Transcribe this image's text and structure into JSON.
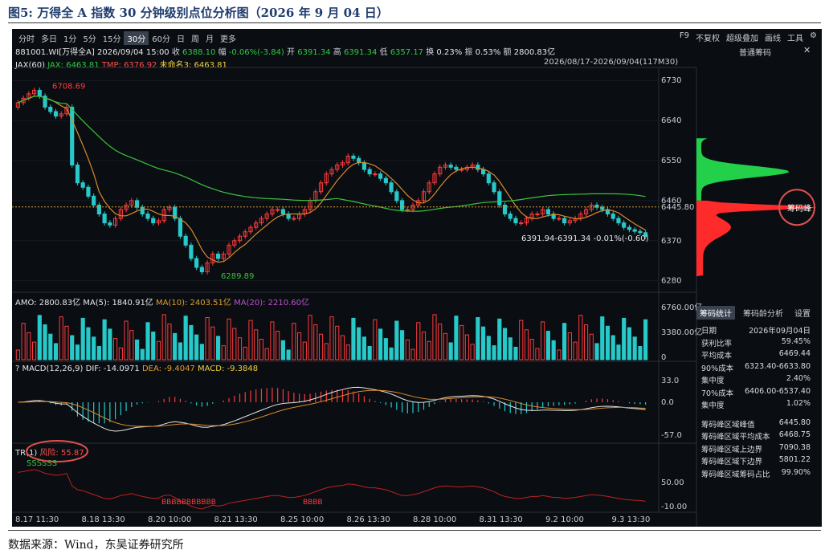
{
  "caption": "图5: 万得全 A 指数 30 分钟级别点位分析图（2026 年 9 月 04 日）",
  "source": "数据来源：Wind，东吴证券研究所",
  "tabs": [
    "分时",
    "多日",
    "1分",
    "5分",
    "15分",
    "30分",
    "60分",
    "日",
    "周",
    "月",
    "更多"
  ],
  "active_tab": "30分",
  "tools": [
    "F9",
    "不复权",
    "超级叠加",
    "画线",
    "工具"
  ],
  "info_line": {
    "code": "881001.WI[万得全A]",
    "datetime": "2026/09/04 15:00",
    "close_lbl": "收",
    "close": "6388.10",
    "chg_lbl": "幅",
    "chg": "-0.06%(-3.84)",
    "open_lbl": "开",
    "open": "6391.34",
    "high_lbl": "高",
    "high": "6391.34",
    "low_lbl": "低",
    "low": "6357.17",
    "turn_lbl": "换",
    "turn": "0.23%",
    "amp_lbl": "振",
    "amp": "0.53%",
    "amt_lbl": "额",
    "amt": "2800.83亿"
  },
  "ma_line": {
    "jax": "JAX(60)",
    "jax_val": "JAX: 6463.81",
    "tmp": "TMP: 6376.92",
    "unnamed": "未命名3: 6463.81"
  },
  "range_text": "2026/08/17-2026/09/04(117M30)",
  "side_title": "普通筹码",
  "annotations": {
    "high": "6708.69",
    "low": "6289.89",
    "range": "6391.94-6391.34  -0.01%(-0.60)",
    "price_tag": "6445.80",
    "peak_label": "筹码峰"
  },
  "amo_line": {
    "amo": "AMO: 2800.83亿",
    "ma5": "MA(5): 1840.91亿",
    "ma10": "MA(10): 2403.51亿",
    "ma20": "MA(20): 2210.60亿"
  },
  "macd_line": {
    "q": "?",
    "macd": "MACD(12,26,9)",
    "dif": "DIF: -14.0971",
    "dea": "DEA: -9.4047",
    "m": "MACD: -9.3848"
  },
  "tr_line": {
    "tr": "TR(1)",
    "risk": "风险: 55.87",
    "s_marks": "SSSSSS",
    "b1": "BBBBBBBBBBB",
    "b2": "BBBB"
  },
  "stat_tabs": [
    "筹码统计",
    "筹码龄分析",
    "设置"
  ],
  "stats": [
    [
      "日期",
      "2026年09月04日"
    ],
    [
      "获利比率",
      "59.45%"
    ],
    [
      "平均成本",
      "6469.44"
    ],
    [
      "90%成本",
      "6323.40-6633.80"
    ],
    [
      "集中度",
      "2.40%"
    ],
    [
      "70%成本",
      "6406.00-6537.40"
    ],
    [
      "集中度",
      "1.02%"
    ],
    [
      "筹码峰区域峰值",
      "6445.80"
    ],
    [
      "筹码峰区域平均成本",
      "6468.75"
    ],
    [
      "筹码峰区域上边界",
      "7090.38"
    ],
    [
      "筹码峰区域下边界",
      "5801.22"
    ],
    [
      "筹码峰区域筹码占比",
      "99.90%"
    ]
  ],
  "colors": {
    "up": "#ff3b3b",
    "down": "#27c9c9",
    "ma_orange": "#d98a2b",
    "ma_green": "#3bc43b",
    "chip_green": "#22d04a",
    "chip_red": "#ff2a2a",
    "circle": "#e05050"
  },
  "chart_data": {
    "type": "candlestick",
    "title": "万得全 A 指数 30 分钟级别点位分析图",
    "price_axis": [
      6730,
      6640,
      6550,
      6460,
      6370,
      6280
    ],
    "price_ylim": [
      6265,
      6752
    ],
    "amo_axis": [
      "6760.00亿",
      "3380.00亿",
      "0"
    ],
    "macd_axis": [
      33.0,
      0.0,
      -57.0
    ],
    "tr_axis": [
      50.0,
      -10.0
    ],
    "x_labels": [
      "8.17 11:30",
      "8.18 13:30",
      "8.20 10:00",
      "8.21 13:30",
      "8.25 10:00",
      "8.26 13:30",
      "8.28 10:00",
      "8.31 13:30",
      "9.2 10:00",
      "9.3 13:30"
    ],
    "close": [
      6680,
      6690,
      6700,
      6708,
      6695,
      6670,
      6660,
      6650,
      6655,
      6670,
      6540,
      6500,
      6490,
      6470,
      6450,
      6430,
      6410,
      6405,
      6420,
      6440,
      6450,
      6460,
      6445,
      6430,
      6420,
      6410,
      6415,
      6440,
      6445,
      6420,
      6380,
      6360,
      6330,
      6310,
      6300,
      6320,
      6340,
      6330,
      6340,
      6360,
      6370,
      6380,
      6390,
      6400,
      6410,
      6420,
      6430,
      6440,
      6440,
      6430,
      6420,
      6420,
      6430,
      6440,
      6460,
      6480,
      6500,
      6520,
      6530,
      6540,
      6545,
      6560,
      6555,
      6545,
      6530,
      6520,
      6520,
      6510,
      6500,
      6480,
      6460,
      6440,
      6440,
      6450,
      6460,
      6480,
      6500,
      6520,
      6535,
      6540,
      6535,
      6530,
      6530,
      6535,
      6540,
      6530,
      6520,
      6500,
      6480,
      6450,
      6430,
      6420,
      6410,
      6410,
      6420,
      6430,
      6430,
      6440,
      6430,
      6420,
      6420,
      6410,
      6415,
      6420,
      6430,
      6440,
      6450,
      6445,
      6440,
      6430,
      6420,
      6410,
      6400,
      6395,
      6391,
      6388,
      6380
    ]
  }
}
